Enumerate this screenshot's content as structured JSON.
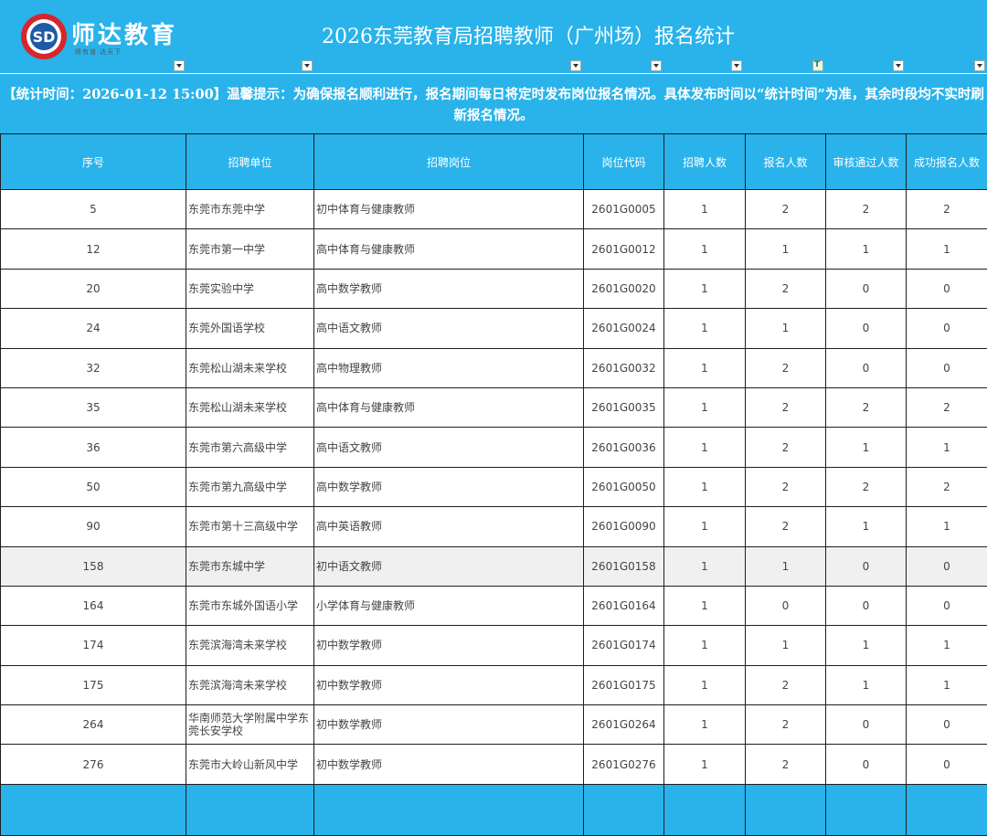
{
  "brand": {
    "name": "师达教育",
    "slogan": "师有道    达天下"
  },
  "title": "2026东莞教育局招聘教师（广州场）报名统计",
  "notice": "【统计时间：2026-01-12 15:00】温馨提示：为确保报名顺利进行，报名期间每日将定时发布岗位报名情况。具体发布时间以“统计时间”为准，其余时段均不实时刷新报名情况。",
  "columns": [
    "序号",
    "招聘单位",
    "招聘岗位",
    "岗位代码",
    "招聘人数",
    "报名人数",
    "审核通过人数",
    "成功报名人数"
  ],
  "rows": [
    [
      "5",
      "东莞市东莞中学",
      "初中体育与健康教师",
      "2601G0005",
      "1",
      "2",
      "2",
      "2"
    ],
    [
      "12",
      "东莞市第一中学",
      "高中体育与健康教师",
      "2601G0012",
      "1",
      "1",
      "1",
      "1"
    ],
    [
      "20",
      "东莞实验中学",
      "高中数学教师",
      "2601G0020",
      "1",
      "2",
      "0",
      "0"
    ],
    [
      "24",
      "东莞外国语学校",
      "高中语文教师",
      "2601G0024",
      "1",
      "1",
      "0",
      "0"
    ],
    [
      "32",
      "东莞松山湖未来学校",
      "高中物理教师",
      "2601G0032",
      "1",
      "2",
      "0",
      "0"
    ],
    [
      "35",
      "东莞松山湖未来学校",
      "高中体育与健康教师",
      "2601G0035",
      "1",
      "2",
      "2",
      "2"
    ],
    [
      "36",
      "东莞市第六高级中学",
      "高中语文教师",
      "2601G0036",
      "1",
      "2",
      "1",
      "1"
    ],
    [
      "50",
      "东莞市第九高级中学",
      "高中数学教师",
      "2601G0050",
      "1",
      "2",
      "2",
      "2"
    ],
    [
      "90",
      "东莞市第十三高级中学",
      "高中英语教师",
      "2601G0090",
      "1",
      "2",
      "1",
      "1"
    ],
    [
      "158",
      "东莞市东城中学",
      "初中语文教师",
      "2601G0158",
      "1",
      "1",
      "0",
      "0"
    ],
    [
      "164",
      "东莞市东城外国语小学",
      "小学体育与健康教师",
      "2601G0164",
      "1",
      "0",
      "0",
      "0"
    ],
    [
      "174",
      "东莞滨海湾未来学校",
      "初中数学教师",
      "2601G0174",
      "1",
      "1",
      "1",
      "1"
    ],
    [
      "175",
      "东莞滨海湾未来学校",
      "初中数学教师",
      "2601G0175",
      "1",
      "2",
      "1",
      "1"
    ],
    [
      "264",
      "华南师范大学附属中学东莞长安学校",
      "初中数学教师",
      "2601G0264",
      "1",
      "2",
      "0",
      "0"
    ],
    [
      "276",
      "东莞市大岭山新风中学",
      "初中数学教师",
      "2601G0276",
      "1",
      "2",
      "0",
      "0"
    ]
  ],
  "colors": {
    "header_bg": "#29b3ea",
    "highlight_row": "#f0f0f0"
  }
}
